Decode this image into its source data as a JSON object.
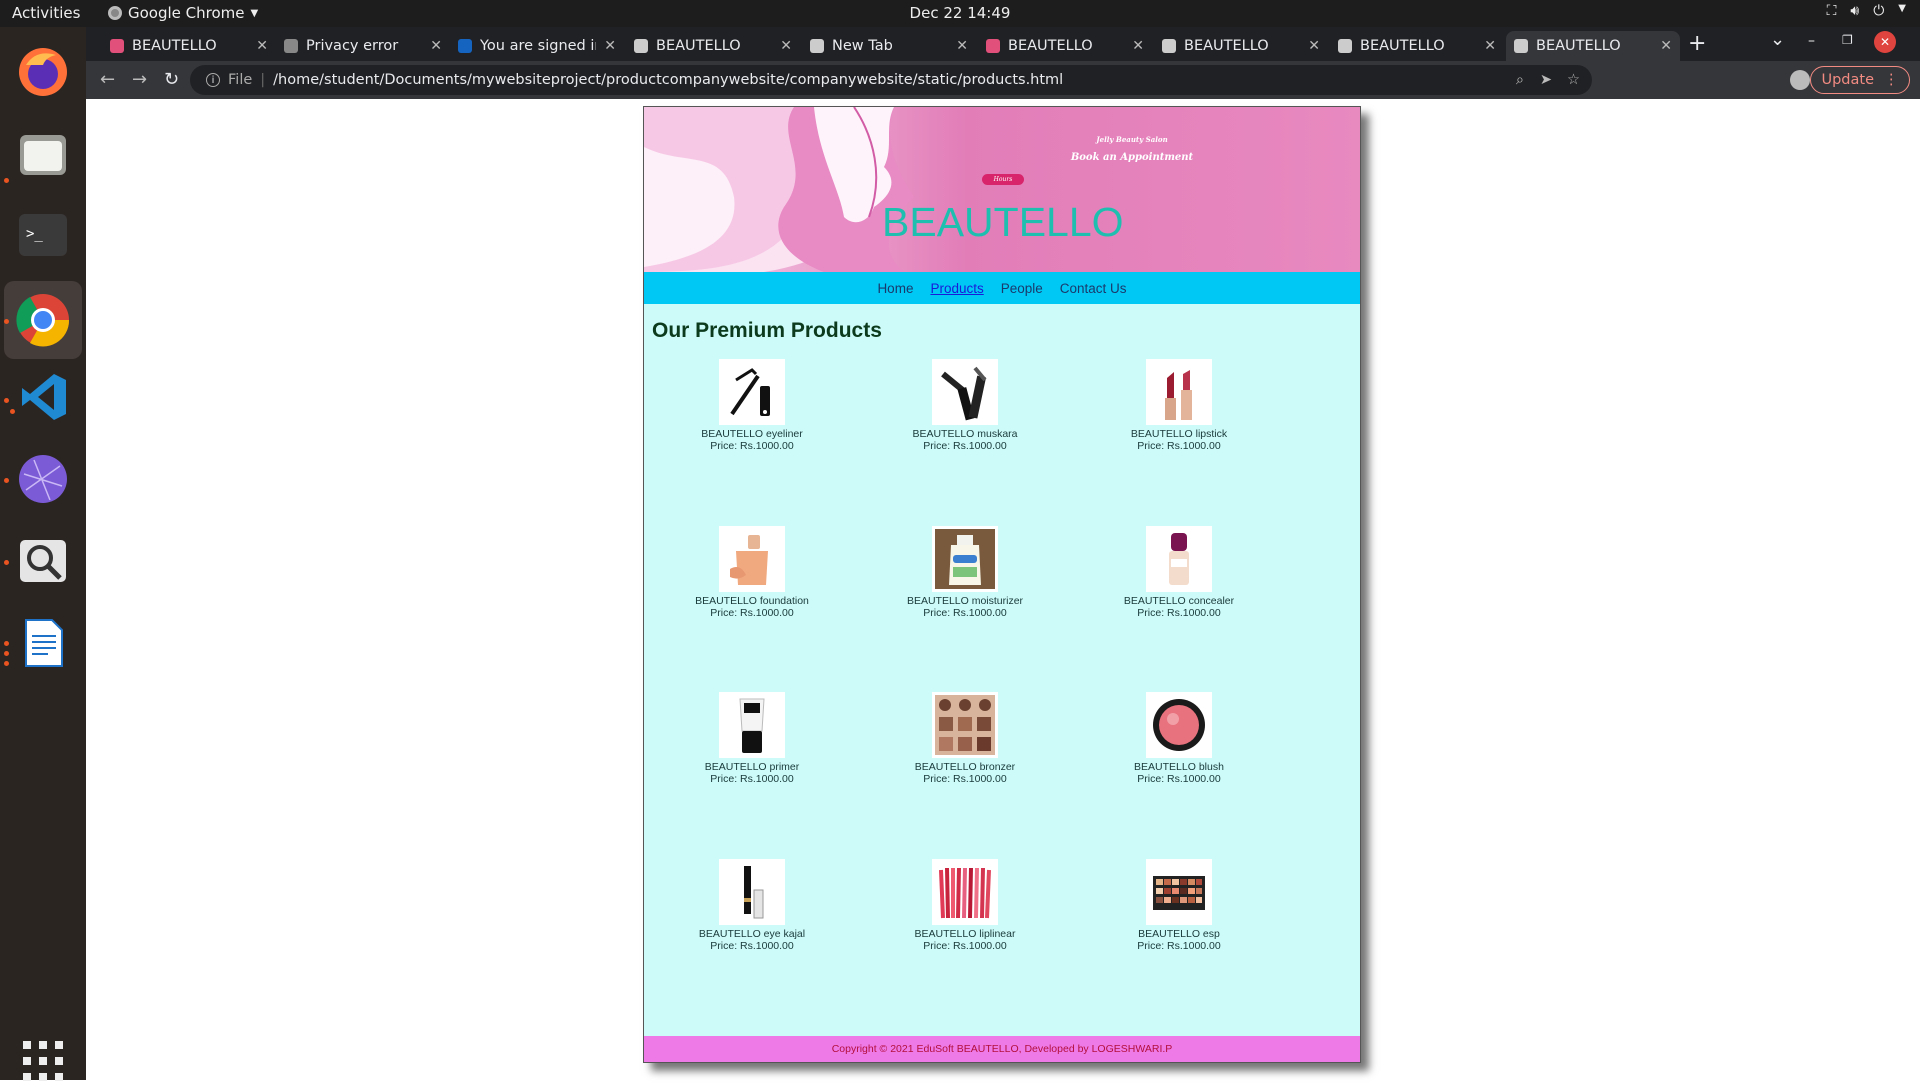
{
  "topbar": {
    "activities": "Activities",
    "app_name": "Google Chrome",
    "clock": "Dec 22  14:49"
  },
  "tabs": [
    {
      "title": "BEAUTELLO",
      "fav_color": "#e0507a"
    },
    {
      "title": "Privacy error",
      "fav_color": "#888888"
    },
    {
      "title": "You are signed in",
      "fav_color": "#1565c0"
    },
    {
      "title": "BEAUTELLO",
      "fav_color": "#cccccc"
    },
    {
      "title": "New Tab",
      "fav_color": "#cccccc"
    },
    {
      "title": "BEAUTELLO",
      "fav_color": "#e0507a"
    },
    {
      "title": "BEAUTELLO",
      "fav_color": "#cccccc"
    },
    {
      "title": "BEAUTELLO",
      "fav_color": "#cccccc"
    },
    {
      "title": "BEAUTELLO",
      "fav_color": "#cccccc"
    }
  ],
  "omnibox": {
    "scheme": "File",
    "url": "/home/student/Documents/mywebsiteproject/productcompanywebsite/companywebsite/static/products.html"
  },
  "update_label": "Update",
  "banner": {
    "salon": "Jelly Beauty Salon",
    "appointment": "Book an Appointment",
    "hours_badge": "Hours",
    "brand": "BEAUTELLO"
  },
  "nav": {
    "home": "Home",
    "products": "Products",
    "people": "People",
    "contact": "Contact Us"
  },
  "heading": "Our Premium Products",
  "products": [
    {
      "name": "BEAUTELLO eyeliner",
      "price": "Price: Rs.1000.00",
      "icon": "eyeliner-icon"
    },
    {
      "name": "BEAUTELLO muskara",
      "price": "Price: Rs.1000.00",
      "icon": "mascara-icon"
    },
    {
      "name": "BEAUTELLO lipstick",
      "price": "Price: Rs.1000.00",
      "icon": "lipstick-icon"
    },
    {
      "name": "BEAUTELLO foundation",
      "price": "Price: Rs.1000.00",
      "icon": "foundation-icon"
    },
    {
      "name": "BEAUTELLO moisturizer",
      "price": "Price: Rs.1000.00",
      "icon": "moisturizer-icon"
    },
    {
      "name": "BEAUTELLO concealer",
      "price": "Price: Rs.1000.00",
      "icon": "concealer-icon"
    },
    {
      "name": "BEAUTELLO primer",
      "price": "Price: Rs.1000.00",
      "icon": "primer-icon"
    },
    {
      "name": "BEAUTELLO bronzer",
      "price": "Price: Rs.1000.00",
      "icon": "bronzer-icon"
    },
    {
      "name": "BEAUTELLO blush",
      "price": "Price: Rs.1000.00",
      "icon": "blush-icon"
    },
    {
      "name": "BEAUTELLO eye kajal",
      "price": "Price: Rs.1000.00",
      "icon": "kajal-icon"
    },
    {
      "name": "BEAUTELLO liplinear",
      "price": "Price: Rs.1000.00",
      "icon": "lipliner-icon"
    },
    {
      "name": "BEAUTELLO esp",
      "price": "Price: Rs.1000.00",
      "icon": "eyeshadow-palette-icon"
    }
  ],
  "footer": "Copyright © 2021 EduSoft BEAUTELLO, Developed by LOGESHWARI.P",
  "colors": {
    "banner_pink": "#e27db8",
    "nav_cyan": "#00c8f5",
    "content_bg": "#ccfbf9",
    "footer_pink": "#ee7ae8",
    "brand_teal": "#1fbfb0"
  }
}
